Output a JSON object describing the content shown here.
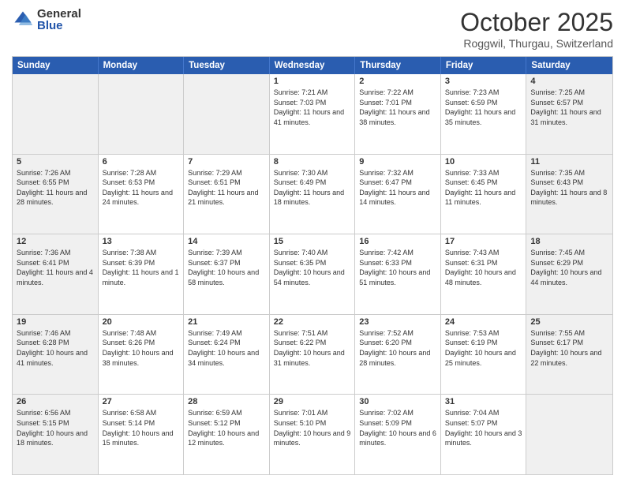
{
  "header": {
    "logo_general": "General",
    "logo_blue": "Blue",
    "month_title": "October 2025",
    "subtitle": "Roggwil, Thurgau, Switzerland"
  },
  "days_of_week": [
    "Sunday",
    "Monday",
    "Tuesday",
    "Wednesday",
    "Thursday",
    "Friday",
    "Saturday"
  ],
  "weeks": [
    [
      {
        "day": "",
        "info": "",
        "shaded": true
      },
      {
        "day": "",
        "info": "",
        "shaded": true
      },
      {
        "day": "",
        "info": "",
        "shaded": true
      },
      {
        "day": "1",
        "info": "Sunrise: 7:21 AM\nSunset: 7:03 PM\nDaylight: 11 hours and 41 minutes.",
        "shaded": false
      },
      {
        "day": "2",
        "info": "Sunrise: 7:22 AM\nSunset: 7:01 PM\nDaylight: 11 hours and 38 minutes.",
        "shaded": false
      },
      {
        "day": "3",
        "info": "Sunrise: 7:23 AM\nSunset: 6:59 PM\nDaylight: 11 hours and 35 minutes.",
        "shaded": false
      },
      {
        "day": "4",
        "info": "Sunrise: 7:25 AM\nSunset: 6:57 PM\nDaylight: 11 hours and 31 minutes.",
        "shaded": true
      }
    ],
    [
      {
        "day": "5",
        "info": "Sunrise: 7:26 AM\nSunset: 6:55 PM\nDaylight: 11 hours and 28 minutes.",
        "shaded": true
      },
      {
        "day": "6",
        "info": "Sunrise: 7:28 AM\nSunset: 6:53 PM\nDaylight: 11 hours and 24 minutes.",
        "shaded": false
      },
      {
        "day": "7",
        "info": "Sunrise: 7:29 AM\nSunset: 6:51 PM\nDaylight: 11 hours and 21 minutes.",
        "shaded": false
      },
      {
        "day": "8",
        "info": "Sunrise: 7:30 AM\nSunset: 6:49 PM\nDaylight: 11 hours and 18 minutes.",
        "shaded": false
      },
      {
        "day": "9",
        "info": "Sunrise: 7:32 AM\nSunset: 6:47 PM\nDaylight: 11 hours and 14 minutes.",
        "shaded": false
      },
      {
        "day": "10",
        "info": "Sunrise: 7:33 AM\nSunset: 6:45 PM\nDaylight: 11 hours and 11 minutes.",
        "shaded": false
      },
      {
        "day": "11",
        "info": "Sunrise: 7:35 AM\nSunset: 6:43 PM\nDaylight: 11 hours and 8 minutes.",
        "shaded": true
      }
    ],
    [
      {
        "day": "12",
        "info": "Sunrise: 7:36 AM\nSunset: 6:41 PM\nDaylight: 11 hours and 4 minutes.",
        "shaded": true
      },
      {
        "day": "13",
        "info": "Sunrise: 7:38 AM\nSunset: 6:39 PM\nDaylight: 11 hours and 1 minute.",
        "shaded": false
      },
      {
        "day": "14",
        "info": "Sunrise: 7:39 AM\nSunset: 6:37 PM\nDaylight: 10 hours and 58 minutes.",
        "shaded": false
      },
      {
        "day": "15",
        "info": "Sunrise: 7:40 AM\nSunset: 6:35 PM\nDaylight: 10 hours and 54 minutes.",
        "shaded": false
      },
      {
        "day": "16",
        "info": "Sunrise: 7:42 AM\nSunset: 6:33 PM\nDaylight: 10 hours and 51 minutes.",
        "shaded": false
      },
      {
        "day": "17",
        "info": "Sunrise: 7:43 AM\nSunset: 6:31 PM\nDaylight: 10 hours and 48 minutes.",
        "shaded": false
      },
      {
        "day": "18",
        "info": "Sunrise: 7:45 AM\nSunset: 6:29 PM\nDaylight: 10 hours and 44 minutes.",
        "shaded": true
      }
    ],
    [
      {
        "day": "19",
        "info": "Sunrise: 7:46 AM\nSunset: 6:28 PM\nDaylight: 10 hours and 41 minutes.",
        "shaded": true
      },
      {
        "day": "20",
        "info": "Sunrise: 7:48 AM\nSunset: 6:26 PM\nDaylight: 10 hours and 38 minutes.",
        "shaded": false
      },
      {
        "day": "21",
        "info": "Sunrise: 7:49 AM\nSunset: 6:24 PM\nDaylight: 10 hours and 34 minutes.",
        "shaded": false
      },
      {
        "day": "22",
        "info": "Sunrise: 7:51 AM\nSunset: 6:22 PM\nDaylight: 10 hours and 31 minutes.",
        "shaded": false
      },
      {
        "day": "23",
        "info": "Sunrise: 7:52 AM\nSunset: 6:20 PM\nDaylight: 10 hours and 28 minutes.",
        "shaded": false
      },
      {
        "day": "24",
        "info": "Sunrise: 7:53 AM\nSunset: 6:19 PM\nDaylight: 10 hours and 25 minutes.",
        "shaded": false
      },
      {
        "day": "25",
        "info": "Sunrise: 7:55 AM\nSunset: 6:17 PM\nDaylight: 10 hours and 22 minutes.",
        "shaded": true
      }
    ],
    [
      {
        "day": "26",
        "info": "Sunrise: 6:56 AM\nSunset: 5:15 PM\nDaylight: 10 hours and 18 minutes.",
        "shaded": true
      },
      {
        "day": "27",
        "info": "Sunrise: 6:58 AM\nSunset: 5:14 PM\nDaylight: 10 hours and 15 minutes.",
        "shaded": false
      },
      {
        "day": "28",
        "info": "Sunrise: 6:59 AM\nSunset: 5:12 PM\nDaylight: 10 hours and 12 minutes.",
        "shaded": false
      },
      {
        "day": "29",
        "info": "Sunrise: 7:01 AM\nSunset: 5:10 PM\nDaylight: 10 hours and 9 minutes.",
        "shaded": false
      },
      {
        "day": "30",
        "info": "Sunrise: 7:02 AM\nSunset: 5:09 PM\nDaylight: 10 hours and 6 minutes.",
        "shaded": false
      },
      {
        "day": "31",
        "info": "Sunrise: 7:04 AM\nSunset: 5:07 PM\nDaylight: 10 hours and 3 minutes.",
        "shaded": false
      },
      {
        "day": "",
        "info": "",
        "shaded": true
      }
    ]
  ]
}
